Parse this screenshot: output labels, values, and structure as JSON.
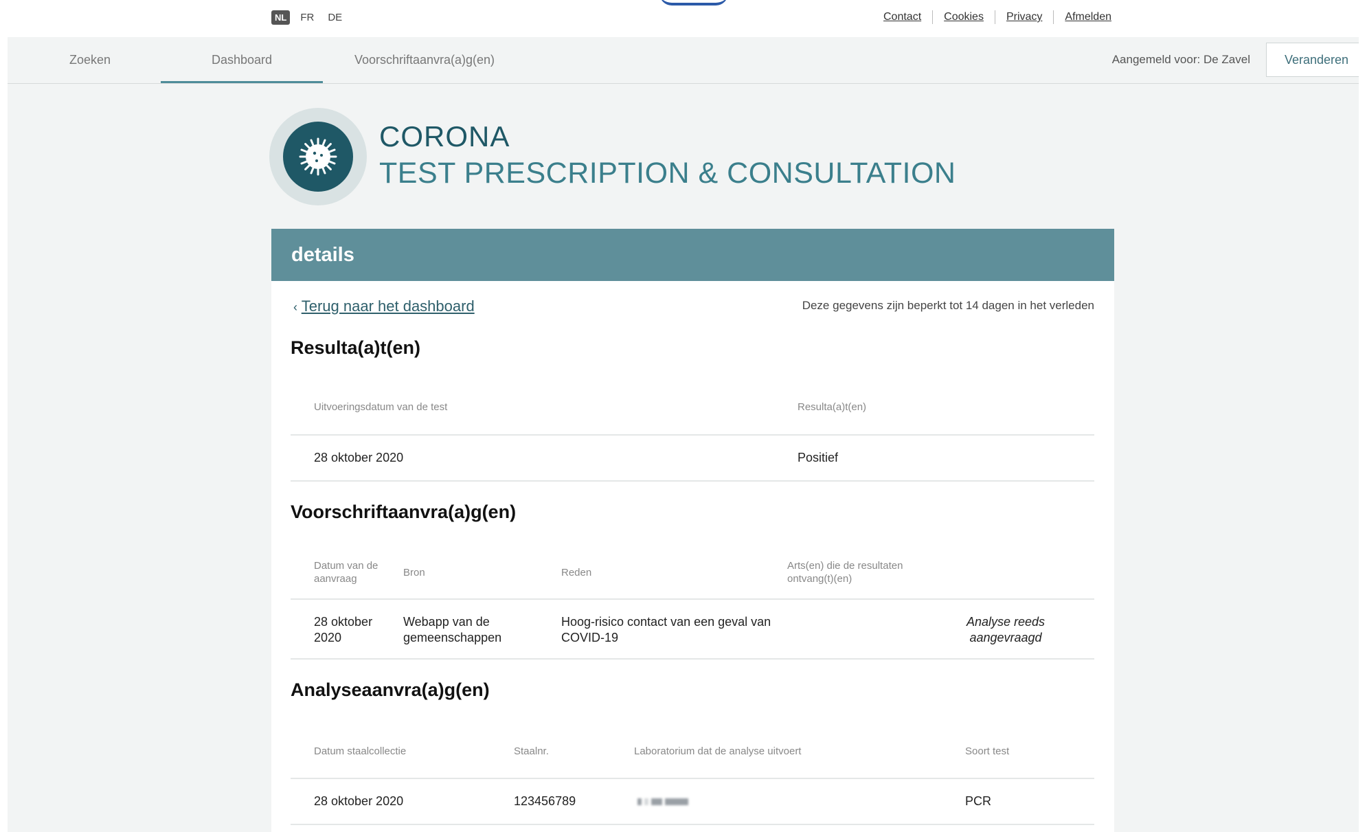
{
  "languages": {
    "active": "NL",
    "others": [
      "FR",
      "DE"
    ]
  },
  "top_links": [
    "Contact",
    "Cookies",
    "Privacy",
    "Afmelden"
  ],
  "nav": {
    "items": [
      "Zoeken",
      "Dashboard",
      "Voorschriftaanvra(a)g(en)"
    ],
    "active_index": 1,
    "login_label": "Aangemeld voor:",
    "login_name": "De Zavel",
    "change_button": "Veranderen"
  },
  "header": {
    "title": "CORONA",
    "subtitle": "TEST PRESCRIPTION & CONSULTATION",
    "logo_icon": "virus-icon"
  },
  "card": {
    "title": "details",
    "back_link": "Terug naar het dashboard",
    "limit_note": "Deze gegevens zijn beperkt tot 14 dagen in het verleden"
  },
  "results": {
    "heading": "Resulta(a)t(en)",
    "columns": [
      "Uitvoeringsdatum van de test",
      "Resulta(a)t(en)"
    ],
    "rows": [
      [
        "28 oktober 2020",
        "Positief"
      ]
    ]
  },
  "prescriptions": {
    "heading": "Voorschriftaanvra(a)g(en)",
    "columns": [
      "Datum van de aanvraag",
      "Bron",
      "Reden",
      "Arts(en) die de resultaten ontvang(t)(en)"
    ],
    "rows": [
      {
        "date": "28 oktober 2020",
        "source": "Webapp van de gemeenschappen",
        "reason": "Hoog-risico contact van een geval van COVID-19",
        "doctor": "",
        "status": "Analyse reeds aangevraagd"
      }
    ]
  },
  "analyses": {
    "heading": "Analyseaanvra(a)g(en)",
    "columns": [
      "Datum staalcollectie",
      "Staalnr.",
      "Laboratorium dat de analyse uitvoert",
      "Soort test"
    ],
    "rows": [
      {
        "date": "28 oktober 2020",
        "sample": "123456789",
        "lab": "",
        "type": "PCR"
      }
    ]
  },
  "colors": {
    "header_bar": "#5f8f9a",
    "title_dark": "#1f5866",
    "title_light": "#3b7f8c",
    "nav_active": "#4e8c99"
  }
}
